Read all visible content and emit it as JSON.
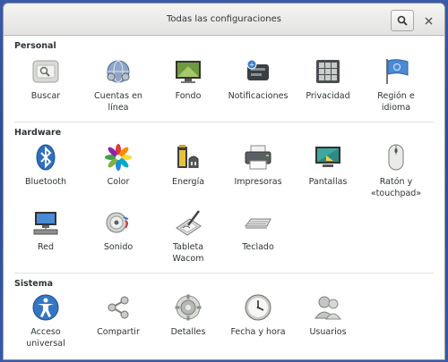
{
  "window": {
    "title": "Todas las configuraciones"
  },
  "sections": {
    "personal": {
      "title": "Personal",
      "items": [
        {
          "label": "Buscar",
          "icon": "search-settings-icon"
        },
        {
          "label": "Cuentas en\nlínea",
          "icon": "online-accounts-icon"
        },
        {
          "label": "Fondo",
          "icon": "background-icon"
        },
        {
          "label": "Notificaciones",
          "icon": "notifications-icon"
        },
        {
          "label": "Privacidad",
          "icon": "privacy-icon"
        },
        {
          "label": "Región e\nidioma",
          "icon": "region-language-icon"
        }
      ]
    },
    "hardware": {
      "title": "Hardware",
      "items": [
        {
          "label": "Bluetooth",
          "icon": "bluetooth-icon"
        },
        {
          "label": "Color",
          "icon": "color-icon"
        },
        {
          "label": "Energía",
          "icon": "power-icon"
        },
        {
          "label": "Impresoras",
          "icon": "printer-icon"
        },
        {
          "label": "Pantallas",
          "icon": "displays-icon"
        },
        {
          "label": "Ratón y\n«touchpad»",
          "icon": "mouse-icon"
        },
        {
          "label": "Red",
          "icon": "network-icon"
        },
        {
          "label": "Sonido",
          "icon": "sound-icon"
        },
        {
          "label": "Tableta\nWacom",
          "icon": "wacom-tablet-icon"
        },
        {
          "label": "Teclado",
          "icon": "keyboard-icon"
        }
      ]
    },
    "sistema": {
      "title": "Sistema",
      "items": [
        {
          "label": "Acceso\nuniversal",
          "icon": "universal-access-icon"
        },
        {
          "label": "Compartir",
          "icon": "sharing-icon"
        },
        {
          "label": "Detalles",
          "icon": "details-icon"
        },
        {
          "label": "Fecha y hora",
          "icon": "clock-icon"
        },
        {
          "label": "Usuarios",
          "icon": "users-icon"
        }
      ]
    }
  }
}
